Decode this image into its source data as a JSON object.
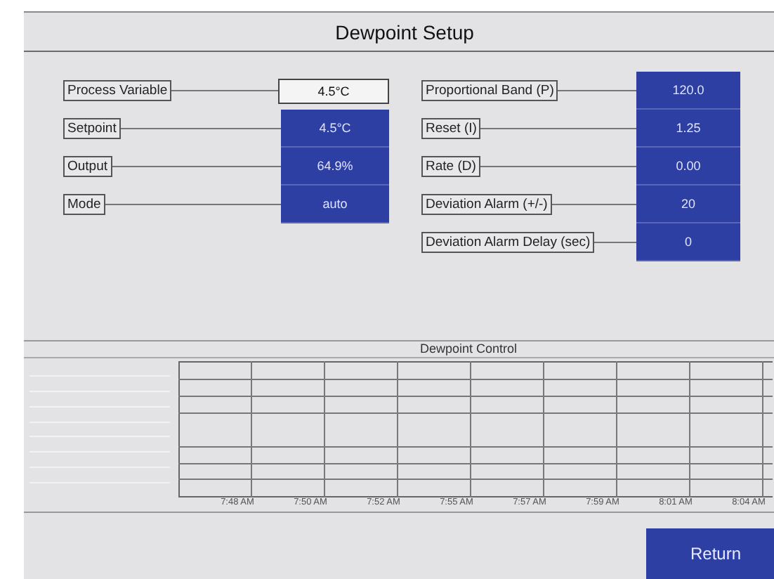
{
  "window": {
    "title": "Dewpoint Setup"
  },
  "left_fields": [
    {
      "label": "Process Variable",
      "value": "4.5°C",
      "kind": "display"
    },
    {
      "label": "Setpoint",
      "value": "4.5°C",
      "kind": "entry"
    },
    {
      "label": "Output",
      "value": "64.9%",
      "kind": "entry"
    },
    {
      "label": "Mode",
      "value": "auto",
      "kind": "entry"
    }
  ],
  "right_fields": [
    {
      "label": "Proportional Band (P)",
      "value": "120.0",
      "kind": "entry"
    },
    {
      "label": "Reset (I)",
      "value": "1.25",
      "kind": "entry"
    },
    {
      "label": "Rate (D)",
      "value": "0.00",
      "kind": "entry"
    },
    {
      "label": "Deviation Alarm (+/-)",
      "value": "20",
      "kind": "entry"
    },
    {
      "label": "Deviation Alarm Delay (sec)",
      "value": "0",
      "kind": "entry"
    }
  ],
  "trend": {
    "title": "Dewpoint Control",
    "time_labels": [
      "7:48 AM",
      "7:50 AM",
      "7:52 AM",
      "7:55 AM",
      "7:57 AM",
      "7:59 AM",
      "8:01 AM",
      "8:04 AM"
    ]
  },
  "buttons": [
    {
      "label": "Return"
    }
  ]
}
